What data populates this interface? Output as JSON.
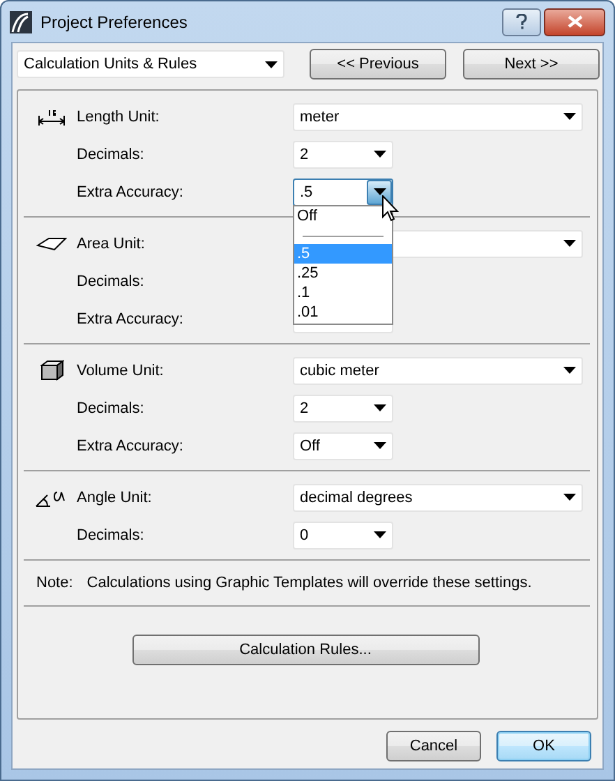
{
  "window": {
    "title": "Project Preferences"
  },
  "page_selector": {
    "value": "Calculation Units & Rules"
  },
  "nav_buttons": [
    "<< Previous",
    "Next >>"
  ],
  "sections": [
    {
      "kind": "length",
      "rows": [
        {
          "label": "Length Unit:",
          "kind": "wide",
          "value": "meter"
        },
        {
          "label": "Decimals:",
          "kind": "short",
          "value": "2"
        },
        {
          "label": "Extra Accuracy:",
          "kind": "short",
          "value": ".5",
          "open": true,
          "options": [
            {
              "kind": "option",
              "text": "Off",
              "selected": false
            },
            {
              "kind": "separator"
            },
            {
              "kind": "option",
              "text": ".5",
              "selected": true
            },
            {
              "kind": "option",
              "text": ".25",
              "selected": false
            },
            {
              "kind": "option",
              "text": ".1",
              "selected": false
            },
            {
              "kind": "option",
              "text": ".01",
              "selected": false
            }
          ]
        }
      ]
    },
    {
      "kind": "area",
      "rows": [
        {
          "label": "Area Unit:",
          "kind": "wide"
        },
        {
          "label": "Decimals:",
          "kind": "short"
        },
        {
          "label": "Extra Accuracy:",
          "kind": "short"
        }
      ]
    },
    {
      "kind": "volume",
      "rows": [
        {
          "label": "Volume Unit:",
          "kind": "wide",
          "value": "cubic meter"
        },
        {
          "label": "Decimals:",
          "kind": "short",
          "value": "2"
        },
        {
          "label": "Extra Accuracy:",
          "kind": "short",
          "value": "Off"
        }
      ]
    },
    {
      "kind": "angle",
      "rows": [
        {
          "label": "Angle Unit:",
          "kind": "wide",
          "value": "decimal degrees"
        },
        {
          "label": "Decimals:",
          "kind": "short",
          "value": "0"
        }
      ]
    }
  ],
  "note": {
    "label": "Note:",
    "text": "Calculations using Graphic Templates will override these settings."
  },
  "rules_button": "Calculation Rules...",
  "footer_buttons": [
    {
      "label": "Cancel",
      "default": false
    },
    {
      "label": "OK",
      "default": true
    }
  ]
}
